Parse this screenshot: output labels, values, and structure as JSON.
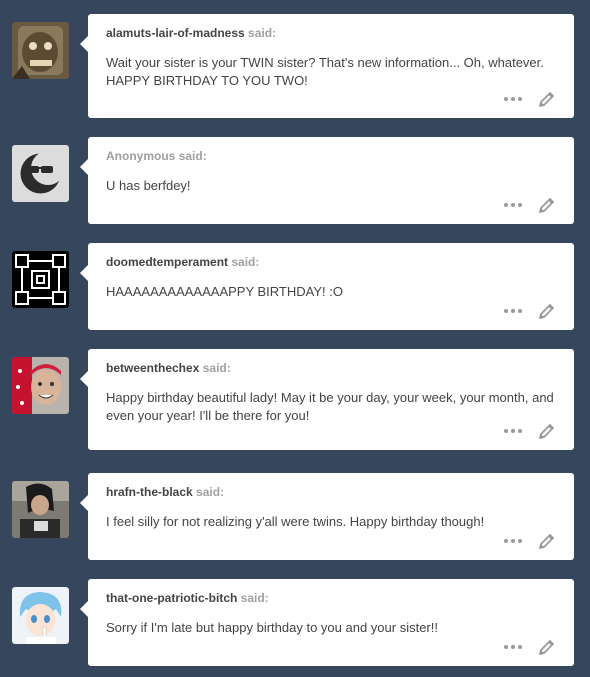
{
  "said_label": "said:",
  "posts": [
    {
      "asker": "alamuts-lair-of-madness",
      "message": "Wait your sister is your TWIN sister? That's new information... Oh, whatever. HAPPY BIRTHDAY TO YOU TWO!"
    },
    {
      "asker": "Anonymous",
      "message": "U has berfdey!"
    },
    {
      "asker": "doomedtemperament",
      "message": "HAAAAAAAAAAAAAPPY BIRTHDAY! :O"
    },
    {
      "asker": "betweenthechex",
      "message": "Happy birthday beautiful lady! May it be your day, your week, your month, and even your year! I'll be there for you!"
    },
    {
      "asker": "hrafn-the-black",
      "message": "I feel silly for not realizing y'all were twins. Happy birthday though!"
    },
    {
      "asker": "that-one-patriotic-bitch",
      "message": "Sorry if I'm late but happy birthday to you and your sister!!"
    }
  ],
  "colors": {
    "background": "#36465d",
    "card": "#ffffff",
    "text": "#444444",
    "muted": "#a0a0a0"
  },
  "icons": [
    "more-options-icon",
    "edit-pencil-icon"
  ]
}
